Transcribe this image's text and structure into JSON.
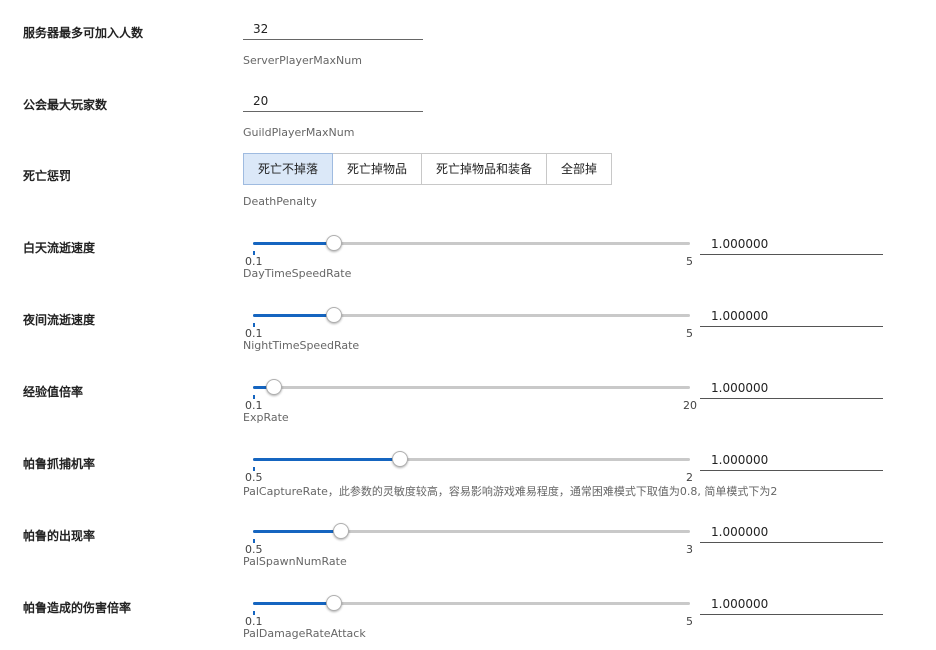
{
  "server_player_max": {
    "label": "服务器最多可加入人数",
    "value": "32",
    "hint": "ServerPlayerMaxNum"
  },
  "guild_player_max": {
    "label": "公会最大玩家数",
    "value": "20",
    "hint": "GuildPlayerMaxNum"
  },
  "death_penalty": {
    "label": "死亡惩罚",
    "hint": "DeathPenalty",
    "options": [
      "死亡不掉落",
      "死亡掉物品",
      "死亡掉物品和装备",
      "全部掉"
    ],
    "selected_index": 0
  },
  "sliders": [
    {
      "label": "白天流逝速度",
      "min": "0.1",
      "max": "5",
      "value": "1.000000",
      "fraction": 0.184,
      "hint": "DayTimeSpeedRate"
    },
    {
      "label": "夜间流逝速度",
      "min": "0.1",
      "max": "5",
      "value": "1.000000",
      "fraction": 0.184,
      "hint": "NightTimeSpeedRate"
    },
    {
      "label": "经验值倍率",
      "min": "0.1",
      "max": "20",
      "value": "1.000000",
      "fraction": 0.045,
      "hint": "ExpRate"
    },
    {
      "label": "帕鲁抓捕机率",
      "min": "0.5",
      "max": "2",
      "value": "1.000000",
      "fraction": 0.333,
      "hint": "PalCaptureRate，此参数的灵敏度较高，容易影响游戏难易程度，通常困难模式下取值为0.8, 简单模式下为2"
    },
    {
      "label": "帕鲁的出现率",
      "min": "0.5",
      "max": "3",
      "value": "1.000000",
      "fraction": 0.2,
      "hint": "PalSpawnNumRate"
    },
    {
      "label": "帕鲁造成的伤害倍率",
      "min": "0.1",
      "max": "5",
      "value": "1.000000",
      "fraction": 0.184,
      "hint": "PalDamageRateAttack"
    }
  ],
  "colors": {
    "accent": "#1565c0",
    "track": "#c9c9c9",
    "selected_bg": "#dbe8f8"
  }
}
